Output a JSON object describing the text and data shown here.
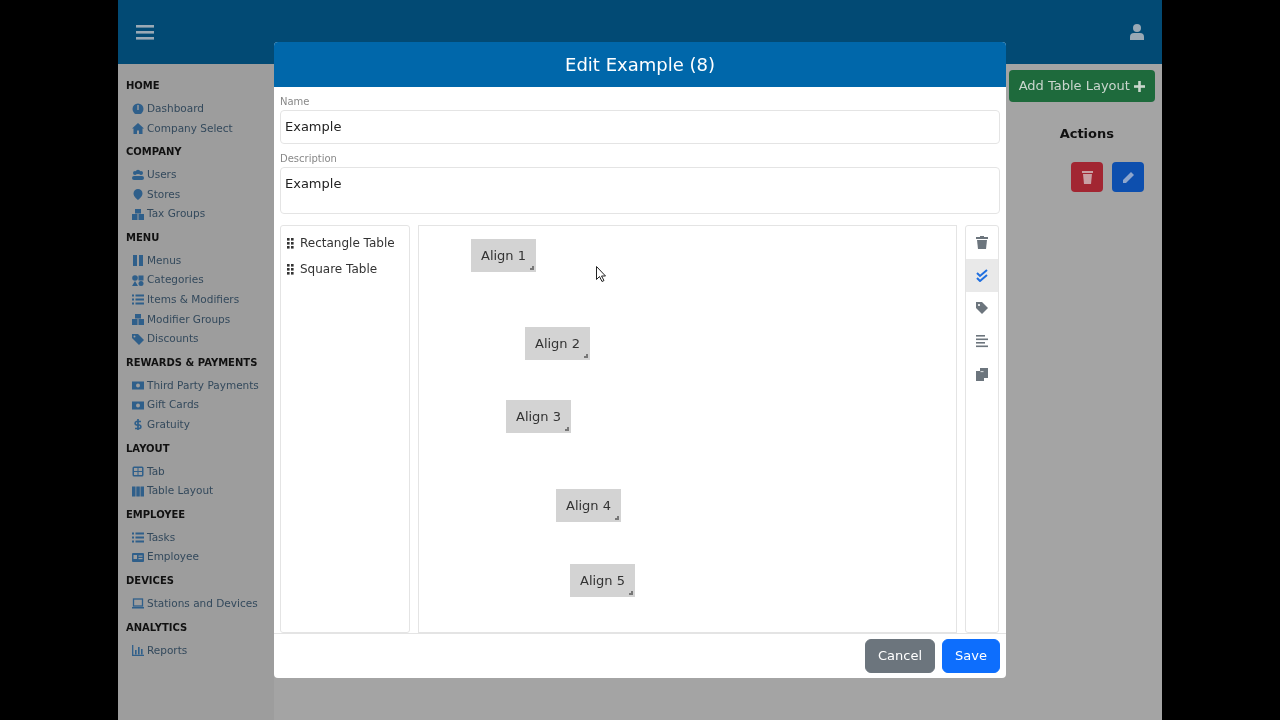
{
  "sidebar": {
    "sections": [
      {
        "heading": "HOME",
        "items": [
          "Dashboard",
          "Company Select"
        ]
      },
      {
        "heading": "COMPANY",
        "items": [
          "Users",
          "Stores",
          "Tax Groups"
        ]
      },
      {
        "heading": "MENU",
        "items": [
          "Menus",
          "Categories",
          "Items & Modifiers",
          "Modifier Groups",
          "Discounts"
        ]
      },
      {
        "heading": "REWARDS & PAYMENTS",
        "items": [
          "Third Party Payments",
          "Gift Cards",
          "Gratuity"
        ]
      },
      {
        "heading": "LAYOUT",
        "items": [
          "Tab",
          "Table Layout"
        ]
      },
      {
        "heading": "EMPLOYEE",
        "items": [
          "Tasks",
          "Employee"
        ]
      },
      {
        "heading": "DEVICES",
        "items": [
          "Stations and Devices"
        ]
      },
      {
        "heading": "ANALYTICS",
        "items": [
          "Reports"
        ]
      }
    ]
  },
  "page": {
    "add_button": "Add Table Layout",
    "actions_heading": "Actions"
  },
  "modal": {
    "title": "Edit Example (8)",
    "name": {
      "label": "Name",
      "value": "Example"
    },
    "description": {
      "label": "Description",
      "value": "Example"
    },
    "palette": [
      "Rectangle Table",
      "Square Table"
    ],
    "tables": [
      "Align 1",
      "Align 2",
      "Align 3",
      "Align 4",
      "Align 5"
    ],
    "tools": [
      {
        "selected": false
      },
      {
        "selected": true
      },
      {
        "selected": false
      },
      {
        "selected": false
      },
      {
        "selected": false
      }
    ],
    "buttons": {
      "cancel": "Cancel",
      "save": "Save"
    }
  }
}
